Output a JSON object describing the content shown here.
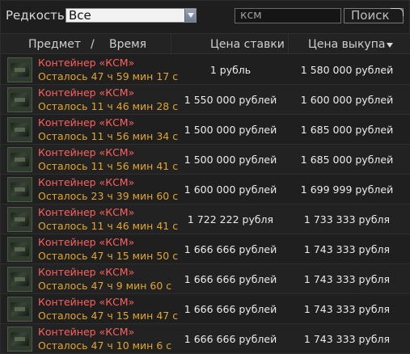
{
  "filter": {
    "rarity_label": "Редкость",
    "rarity_value": "Все",
    "search_value": "ксм",
    "search_button": "Поиск"
  },
  "header": {
    "col_item": "Предмет",
    "slash": "/",
    "col_time": "Время",
    "col_bid": "Цена ставки",
    "col_buyout": "Цена выкупа"
  },
  "rows": [
    {
      "name": "Контейнер «КСМ»",
      "time": "Осталось 47 ч 59 мин 17 с",
      "bid": "1 рубль",
      "buyout": "1 580 000 рублей"
    },
    {
      "name": "Контейнер «КСМ»",
      "time": "Осталось 11 ч 46 мин 28 с",
      "bid": "1 550 000 рублей",
      "buyout": "1 600 000 рублей"
    },
    {
      "name": "Контейнер «КСМ»",
      "time": "Осталось 11 ч 56 мин 34 с",
      "bid": "1 500 000 рублей",
      "buyout": "1 685 000 рублей"
    },
    {
      "name": "Контейнер «КСМ»",
      "time": "Осталось 11 ч 56 мин 41 с",
      "bid": "1 500 000 рублей",
      "buyout": "1 685 000 рублей"
    },
    {
      "name": "Контейнер «КСМ»",
      "time": "Осталось 23 ч 39 мин 60 с",
      "bid": "1 600 000 рублей",
      "buyout": "1 699 999 рублей"
    },
    {
      "name": "Контейнер «КСМ»",
      "time": "Осталось 11 ч 46 мин 41 с",
      "bid": "1 722 222 рубля",
      "buyout": "1 733 333 рубля"
    },
    {
      "name": "Контейнер «КСМ»",
      "time": "Осталось 47 ч 15 мин 50 с",
      "bid": "1 666 666 рублей",
      "buyout": "1 743 333 рубля"
    },
    {
      "name": "Контейнер «КСМ»",
      "time": "Осталось 47 ч 9 мин 60 с",
      "bid": "1 666 666 рублей",
      "buyout": "1 743 333 рубля"
    },
    {
      "name": "Контейнер «КСМ»",
      "time": "Осталось 47 ч 15 мин 47 с",
      "bid": "1 666 666 рублей",
      "buyout": "1 743 333 рубля"
    },
    {
      "name": "Контейнер «КСМ»",
      "time": "Осталось 47 ч 10 мин 6 с",
      "bid": "1 666 666 рублей",
      "buyout": "1 743 333 рубля"
    }
  ],
  "colors": {
    "item_name": "#ff5f5f",
    "time_left": "#e2a62b"
  }
}
